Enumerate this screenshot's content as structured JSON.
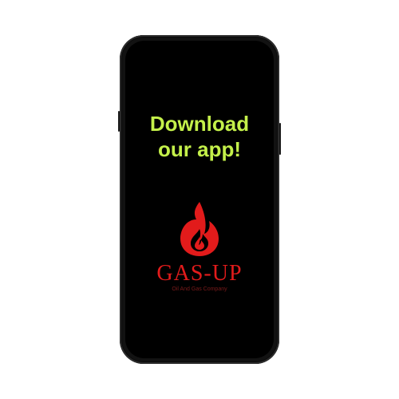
{
  "headline": {
    "line1": "Download",
    "line2": "our app!"
  },
  "logo": {
    "icon": "flame-icon",
    "name": "GAS-UP",
    "tagline": "Oil And Gas Company"
  },
  "colors": {
    "headline": "#c4f04a",
    "brand": "#e21b1b",
    "screen": "#000000"
  }
}
